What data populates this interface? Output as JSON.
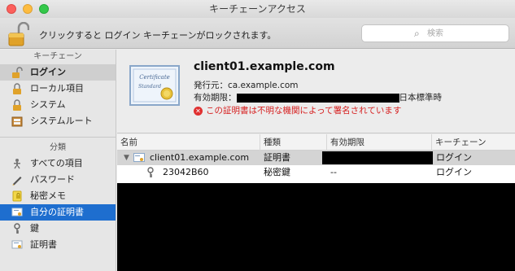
{
  "window": {
    "title": "キーチェーンアクセス"
  },
  "toolbar": {
    "lock_message": "クリックすると ログイン キーチェーンがロックされます。",
    "search_placeholder": "検索"
  },
  "sidebar": {
    "keychain_header": "キーチェーン",
    "keychains": [
      {
        "label": "ログイン",
        "icon": "open-lock-icon",
        "selected": true
      },
      {
        "label": "ローカル項目",
        "icon": "lock-icon"
      },
      {
        "label": "システム",
        "icon": "lock-icon"
      },
      {
        "label": "システムルート",
        "icon": "cabinet-icon"
      }
    ],
    "category_header": "分類",
    "categories": [
      {
        "label": "すべての項目",
        "icon": "people-icon"
      },
      {
        "label": "パスワード",
        "icon": "pencil-icon"
      },
      {
        "label": "秘密メモ",
        "icon": "note-icon"
      },
      {
        "label": "自分の証明書",
        "icon": "cert-icon",
        "selected": true
      },
      {
        "label": "鍵",
        "icon": "key-icon"
      },
      {
        "label": "証明書",
        "icon": "cert-icon"
      }
    ]
  },
  "detail": {
    "name": "client01.example.com",
    "issuer": "発行元：ca.example.com",
    "expiry_label": "有効期限：",
    "expiry_suffix": "日本標準時",
    "warning": "この証明書は不明な機関によって署名されています",
    "cert_image_text": [
      "Certificate",
      "Standard"
    ]
  },
  "table": {
    "columns": [
      "名前",
      "種類",
      "有効期限",
      "キーチェーン"
    ],
    "rows": [
      {
        "name": "client01.example.com",
        "kind": "証明書",
        "expires": "",
        "keychain": "ログイン"
      },
      {
        "name": "23042B60",
        "kind": "秘密鍵",
        "expires": "--",
        "keychain": "ログイン"
      }
    ]
  },
  "colors": {
    "selection_blue": "#1e6ecf",
    "warning_red": "#d62020"
  }
}
